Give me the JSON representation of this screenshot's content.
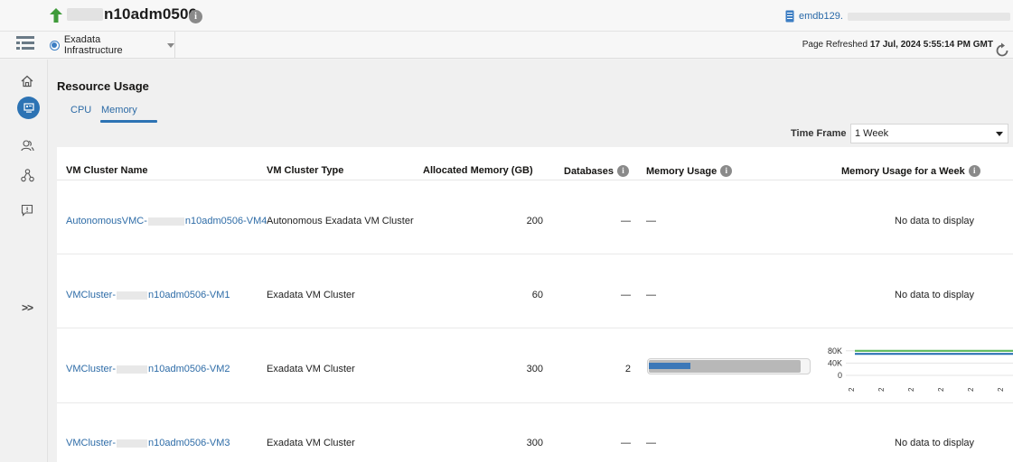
{
  "header": {
    "title": "n10adm0506",
    "db_link": "emdb129."
  },
  "subheader": {
    "context_label": "Exadata Infrastructure",
    "refresh_prefix": "Page Refreshed",
    "refresh_time": "17 Jul, 2024 5:55:14 PM GMT"
  },
  "rail": {
    "icons": [
      "home-icon",
      "target-icon",
      "users-icon",
      "hierarchy-icon",
      "feedback-icon"
    ],
    "expand_label": ">>"
  },
  "main": {
    "section_title": "Resource Usage",
    "tabs": [
      {
        "label": "CPU",
        "selected": false
      },
      {
        "label": "Memory",
        "selected": true
      }
    ],
    "time_frame": {
      "label": "Time Frame",
      "value": "1 Week"
    },
    "columns": [
      "VM Cluster Name",
      "VM Cluster Type",
      "Allocated Memory (GB)",
      "Databases",
      "Memory Usage",
      "Memory Usage for a Week"
    ],
    "rows": [
      {
        "name_prefix": "AutonomousVMC-",
        "name_suffix": "n10adm0506-VM4",
        "type": "Autonomous Exadata VM Cluster",
        "allocated": "200",
        "databases": "—",
        "memory_usage": "—",
        "week": "No data to display"
      },
      {
        "name_prefix": "VMCluster-",
        "name_suffix": "n10adm0506-VM1",
        "type": "Exadata VM Cluster",
        "allocated": "60",
        "databases": "—",
        "memory_usage": "—",
        "week": "No data to display"
      },
      {
        "name_prefix": "VMCluster-",
        "name_suffix": "n10adm0506-VM2",
        "type": "Exadata VM Cluster",
        "allocated": "300",
        "databases": "2",
        "memory_usage": "",
        "week": ""
      },
      {
        "name_prefix": "VMCluster-",
        "name_suffix": "n10adm0506-VM3",
        "type": "Exadata VM Cluster",
        "allocated": "300",
        "databases": "—",
        "memory_usage": "—",
        "week": "No data to display"
      }
    ],
    "memory_bar": {
      "usage_fraction": 0.26,
      "capacity_fraction": 0.95
    }
  },
  "chart_data": {
    "type": "line",
    "ylim": [
      0,
      100000
    ],
    "y_ticks": [
      "80K",
      "40K",
      "0"
    ],
    "x_ticks": [
      "2",
      "2",
      "2",
      "2",
      "2",
      "2"
    ],
    "series": [
      {
        "values": [
          80000,
          80000,
          80000,
          80000,
          80000,
          80000
        ],
        "color": "#5cb85c"
      },
      {
        "values": [
          70000,
          70000,
          70000,
          70000,
          70000,
          70000
        ],
        "color": "#2d73b4"
      }
    ]
  },
  "colors": {
    "accent": "#2d73b4",
    "link": "#2e6ca7",
    "up_arrow": "#3f9b3a"
  }
}
